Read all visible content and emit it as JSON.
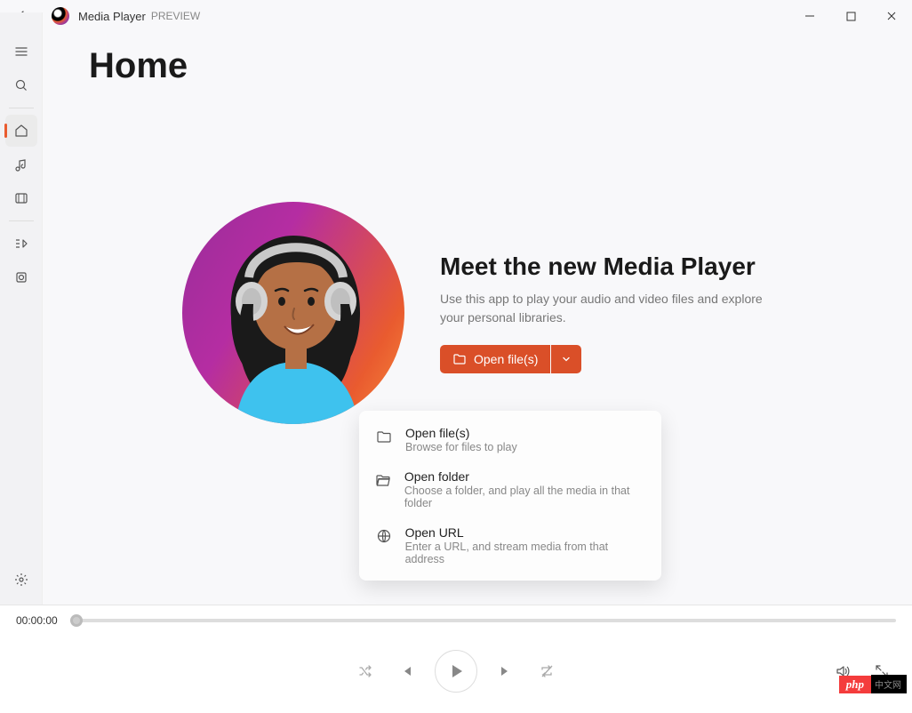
{
  "titlebar": {
    "app_name": "Media Player",
    "preview_label": "PREVIEW"
  },
  "page": {
    "title": "Home"
  },
  "hero": {
    "heading": "Meet the new Media Player",
    "description": "Use this app to play your audio and video files and explore your personal libraries.",
    "open_button_label": "Open file(s)"
  },
  "menu": {
    "items": [
      {
        "title": "Open file(s)",
        "subtitle": "Browse for files to play"
      },
      {
        "title": "Open folder",
        "subtitle": "Choose a folder, and play all the media in that folder"
      },
      {
        "title": "Open URL",
        "subtitle": "Enter a URL, and stream media from that address"
      }
    ]
  },
  "player": {
    "time": "00:00:00"
  },
  "watermark": {
    "php": "php",
    "cn": "中文网"
  }
}
